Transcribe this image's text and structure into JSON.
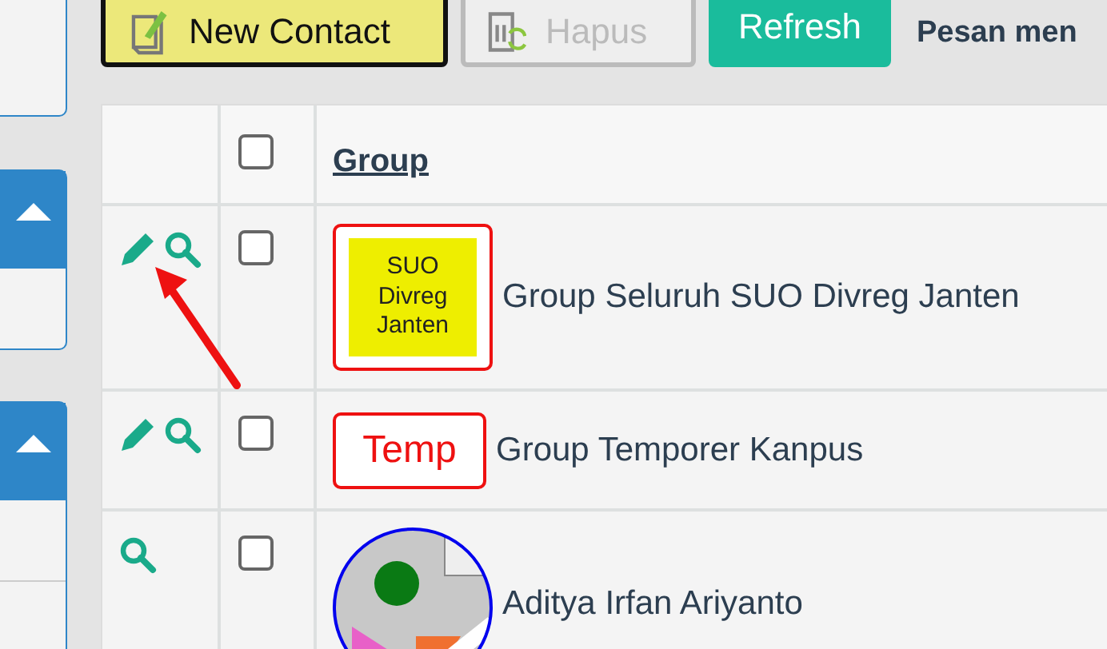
{
  "toolbar": {
    "buttons": [
      {
        "label": "New Contact",
        "kind": "new",
        "disabled": false
      },
      {
        "label": "Hapus",
        "kind": "delete",
        "disabled": true
      },
      {
        "label": "Refresh",
        "kind": "refresh",
        "disabled": false
      }
    ],
    "message": "Pesan men"
  },
  "table": {
    "header": {
      "checked": false,
      "group": "Group"
    },
    "rows": [
      {
        "actions": [
          {
            "kind": "edit"
          },
          {
            "kind": "view"
          }
        ],
        "checked": false,
        "logo": {
          "kind": "tile",
          "text": "SUO Divreg Janten"
        },
        "name": "Group Seluruh SUO Divreg Janten"
      },
      {
        "actions": [
          {
            "kind": "edit"
          },
          {
            "kind": "view"
          }
        ],
        "checked": false,
        "logo": {
          "kind": "label",
          "text": "Temp"
        },
        "name": "Group Temporer Kanpus"
      },
      {
        "actions": [
          {
            "kind": "view"
          }
        ],
        "checked": false,
        "logo": {
          "kind": "avatar"
        },
        "name": "Aditya Irfan Ariyanto"
      }
    ]
  }
}
